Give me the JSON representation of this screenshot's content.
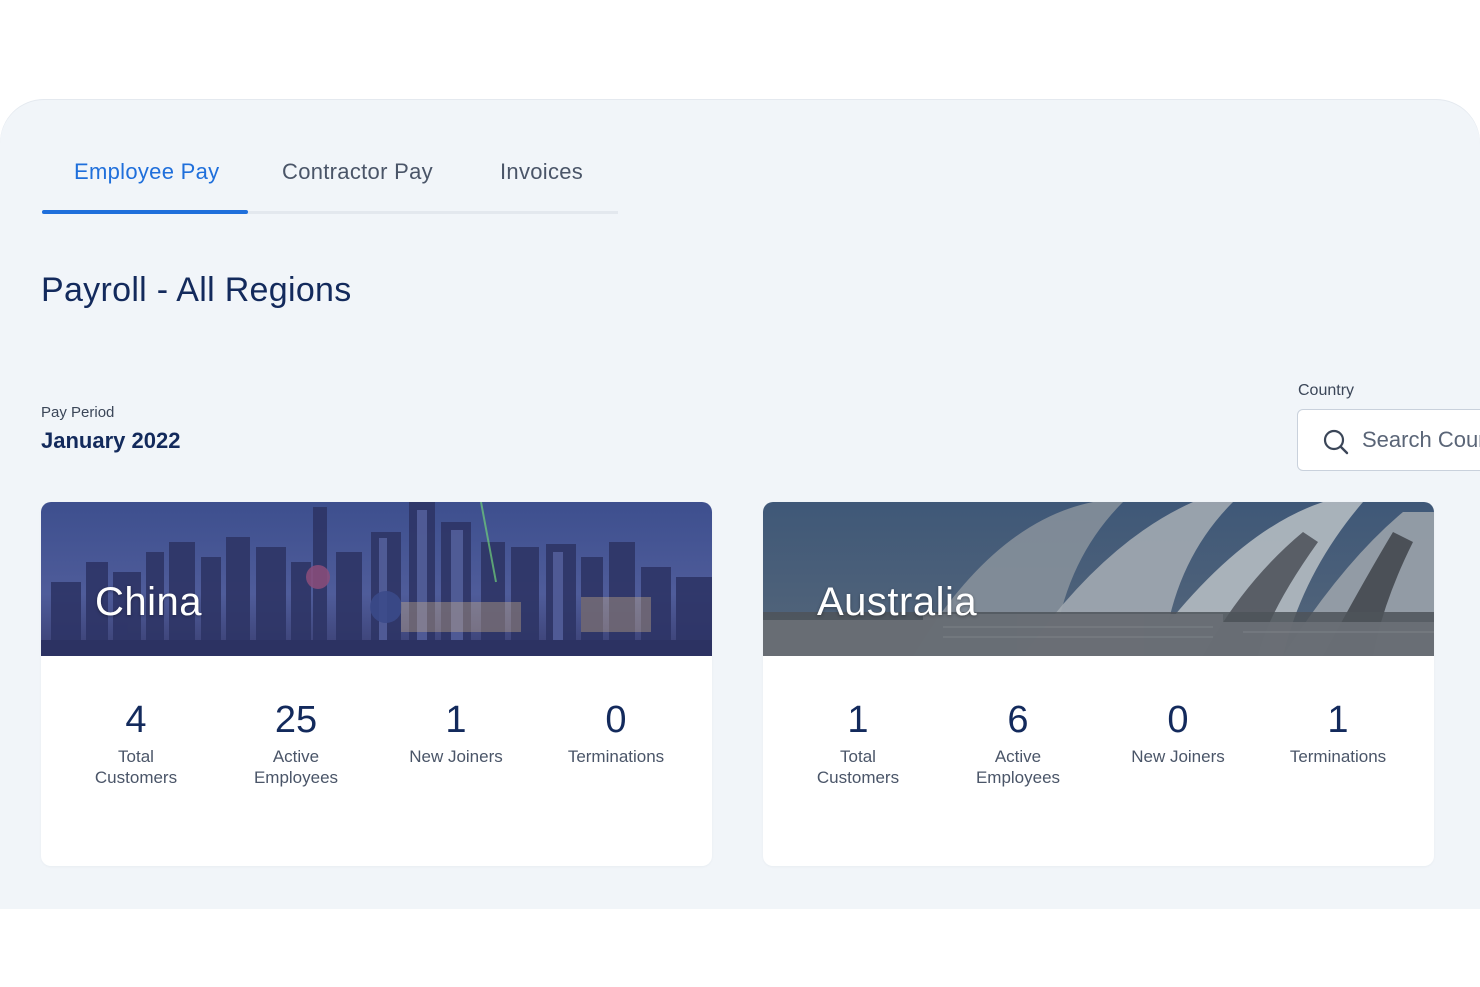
{
  "tabs": [
    {
      "label": "Employee Pay",
      "active": true
    },
    {
      "label": "Contractor Pay",
      "active": false
    },
    {
      "label": "Invoices",
      "active": false
    }
  ],
  "page_title": "Payroll - All Regions",
  "pay_period": {
    "label": "Pay Period",
    "value": "January 2022"
  },
  "country_filter": {
    "label": "Country",
    "placeholder": "Search Country"
  },
  "colors": {
    "accent": "#1f6fdb",
    "navy": "#132a5c",
    "panel_bg": "#f1f5f9"
  },
  "regions": [
    {
      "name": "China",
      "stats": [
        {
          "value": "4",
          "label_line1": "Total",
          "label_line2": "Customers"
        },
        {
          "value": "25",
          "label_line1": "Active",
          "label_line2": "Employees"
        },
        {
          "value": "1",
          "label_line1": "New Joiners",
          "label_line2": ""
        },
        {
          "value": "0",
          "label_line1": "Terminations",
          "label_line2": ""
        }
      ]
    },
    {
      "name": "Australia",
      "stats": [
        {
          "value": "1",
          "label_line1": "Total",
          "label_line2": "Customers"
        },
        {
          "value": "6",
          "label_line1": "Active",
          "label_line2": "Employees"
        },
        {
          "value": "0",
          "label_line1": "New Joiners",
          "label_line2": ""
        },
        {
          "value": "1",
          "label_line1": "Terminations",
          "label_line2": ""
        }
      ]
    }
  ]
}
